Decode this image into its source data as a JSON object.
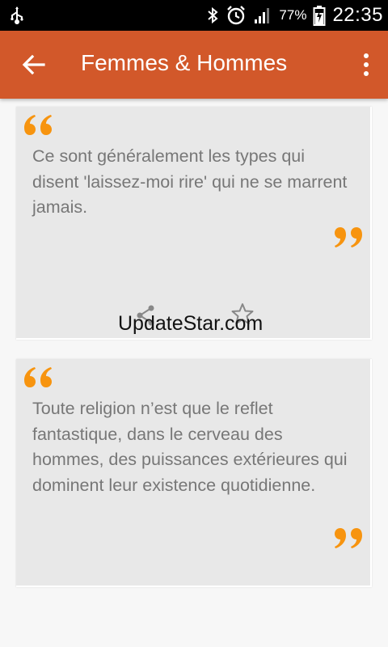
{
  "status_bar": {
    "battery_percent": "77%",
    "time": "22:35",
    "icons": [
      "usb-icon",
      "bluetooth-icon",
      "alarm-icon",
      "signal-icon",
      "battery-icon"
    ]
  },
  "app_bar": {
    "title": "Femmes & Hommes",
    "back_icon": "arrow-back-icon",
    "menu_icon": "more-vert-icon",
    "color": "#d2582a"
  },
  "quotes": [
    {
      "text": "Ce sont généralement les types qui disent 'laissez-moi rire' qui ne se marrent jamais.",
      "actions": [
        "share-icon",
        "star-icon"
      ]
    },
    {
      "text": "Toute religion n’est que le reflet fantastique, dans le cerveau des hommes, des puissances extérieures qui dominent leur existence quotidienne."
    }
  ],
  "watermark": "UpdateStar.com",
  "accent_color": "#f7940f"
}
